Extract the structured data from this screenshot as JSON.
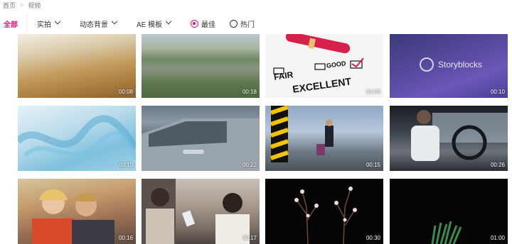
{
  "breadcrumb": {
    "home": "首页",
    "current": "视频"
  },
  "filters": {
    "all_label": "全部",
    "live_action": "实拍",
    "motion_bg": "动态背景",
    "ae_template": "AE 模板",
    "sort_best": "最佳",
    "sort_hot": "热门"
  },
  "thumb_text": {
    "watermark": "Storyblocks",
    "fair": "FAIR",
    "good": "GOOD",
    "excellent": "EXCELLENT"
  },
  "videos": [
    {
      "duration": "00:08"
    },
    {
      "duration": "00:18"
    },
    {
      "duration": "00:08"
    },
    {
      "duration": "00:10"
    },
    {
      "duration": "00:10"
    },
    {
      "duration": "00:22"
    },
    {
      "duration": "00:15"
    },
    {
      "duration": "00:26"
    },
    {
      "duration": "00:16"
    },
    {
      "duration": "00:17"
    },
    {
      "duration": "00:30"
    },
    {
      "duration": "01:00"
    }
  ],
  "colors": {
    "accent": "#e0157a"
  }
}
